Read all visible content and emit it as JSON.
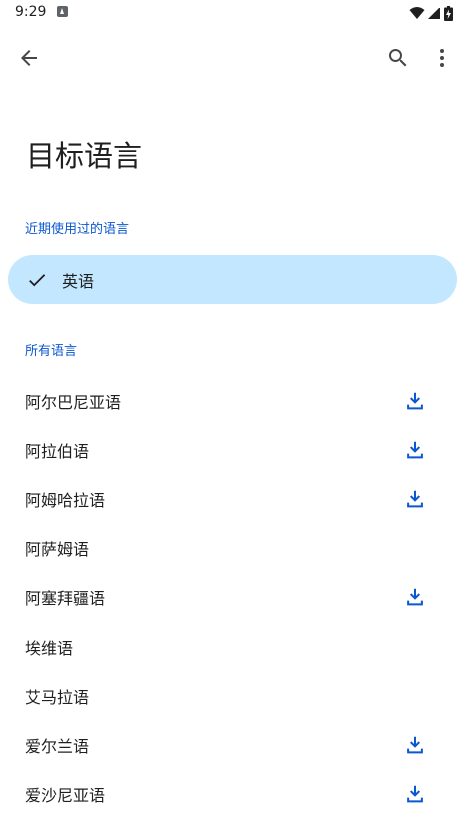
{
  "status_bar": {
    "time": "9:29",
    "icons": [
      "app-notification-icon",
      "wifi-icon",
      "cell-signal-icon",
      "battery-charging-icon"
    ]
  },
  "toolbar": {
    "back_icon": "arrow-back-icon",
    "search_icon": "search-icon",
    "more_icon": "more-vert-icon"
  },
  "title": "目标语言",
  "recent_section": {
    "header": "近期使用过的语言",
    "items": [
      {
        "label": "英语",
        "selected": true
      }
    ]
  },
  "all_section": {
    "header": "所有语言",
    "items": [
      {
        "label": "阿尔巴尼亚语",
        "downloadable": true
      },
      {
        "label": "阿拉伯语",
        "downloadable": true
      },
      {
        "label": "阿姆哈拉语",
        "downloadable": true
      },
      {
        "label": "阿萨姆语",
        "downloadable": false
      },
      {
        "label": "阿塞拜疆语",
        "downloadable": true
      },
      {
        "label": "埃维语",
        "downloadable": false
      },
      {
        "label": "艾马拉语",
        "downloadable": false
      },
      {
        "label": "爱尔兰语",
        "downloadable": true
      },
      {
        "label": "爱沙尼亚语",
        "downloadable": true
      }
    ]
  },
  "colors": {
    "accent": "#0b57d0",
    "selected_bg": "#c2e7ff",
    "text": "#1f1f1f",
    "icon": "#444746",
    "download_icon": "#0b57d0"
  }
}
